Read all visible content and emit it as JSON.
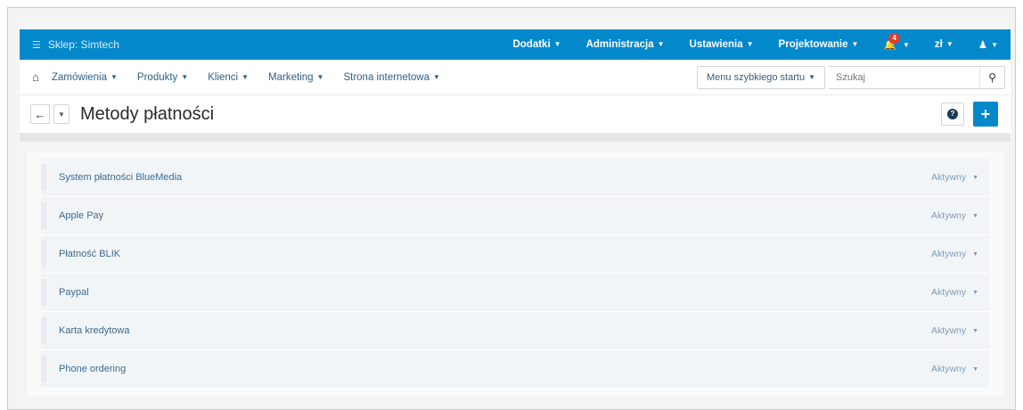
{
  "topbar": {
    "store_label": "Sklep: Simtech",
    "menu": [
      {
        "label": "Dodatki",
        "name": "topnav-dodatki"
      },
      {
        "label": "Administracja",
        "name": "topnav-administracja"
      },
      {
        "label": "Ustawienia",
        "name": "topnav-ustawienia"
      },
      {
        "label": "Projektowanie",
        "name": "topnav-projektowanie"
      }
    ],
    "notifications_count": "4",
    "currency": "zł"
  },
  "subnav": {
    "menu": [
      {
        "label": "Zamówienia"
      },
      {
        "label": "Produkty"
      },
      {
        "label": "Klienci"
      },
      {
        "label": "Marketing"
      },
      {
        "label": "Strona internetowa"
      }
    ],
    "quick_start_label": "Menu szybkiego startu",
    "search_placeholder": "Szukaj"
  },
  "page": {
    "title": "Metody płatności"
  },
  "payment_methods": [
    {
      "name": "System płatności BlueMedia",
      "status": "Aktywny"
    },
    {
      "name": "Apple Pay",
      "status": "Aktywny"
    },
    {
      "name": "Płatność BLIK",
      "status": "Aktywny"
    },
    {
      "name": "Paypal",
      "status": "Aktywny"
    },
    {
      "name": "Karta kredytowa",
      "status": "Aktywny"
    },
    {
      "name": "Phone ordering",
      "status": "Aktywny"
    }
  ],
  "colors": {
    "accent": "#0388cc",
    "badge": "#e43a2a",
    "link": "#3c6a8f"
  }
}
